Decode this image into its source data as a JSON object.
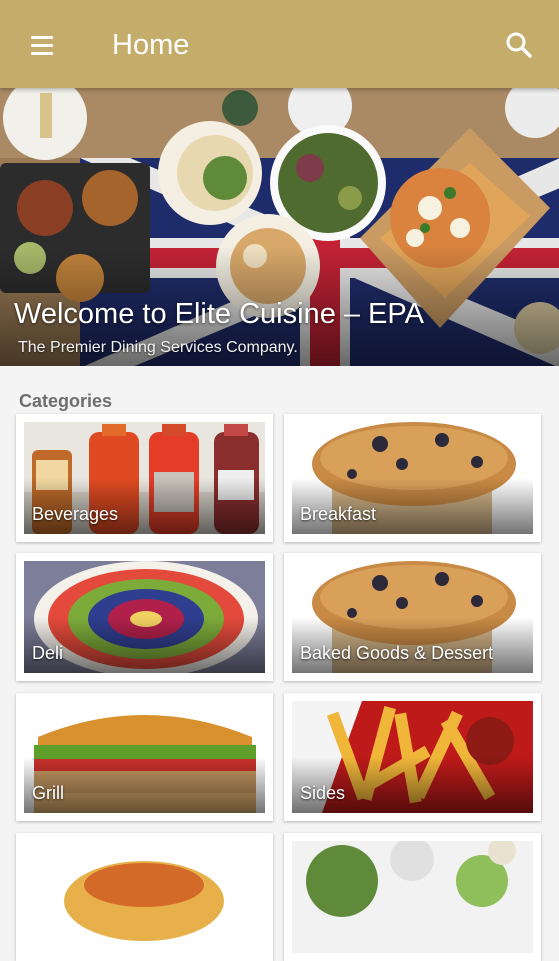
{
  "app_bar": {
    "title": "Home",
    "menu_icon": "menu-icon",
    "search_icon": "search-icon",
    "color": "#c4ad6b"
  },
  "hero": {
    "title": "Welcome to Elite Cuisine – EPA",
    "subtitle": "The Premier Dining Services Company."
  },
  "categories": {
    "heading": "Categories",
    "items": [
      {
        "label": "Beverages"
      },
      {
        "label": "Breakfast"
      },
      {
        "label": "Deli"
      },
      {
        "label": "Baked Goods & Dessert"
      },
      {
        "label": "Grill"
      },
      {
        "label": "Sides"
      },
      {
        "label": ""
      },
      {
        "label": ""
      }
    ]
  }
}
